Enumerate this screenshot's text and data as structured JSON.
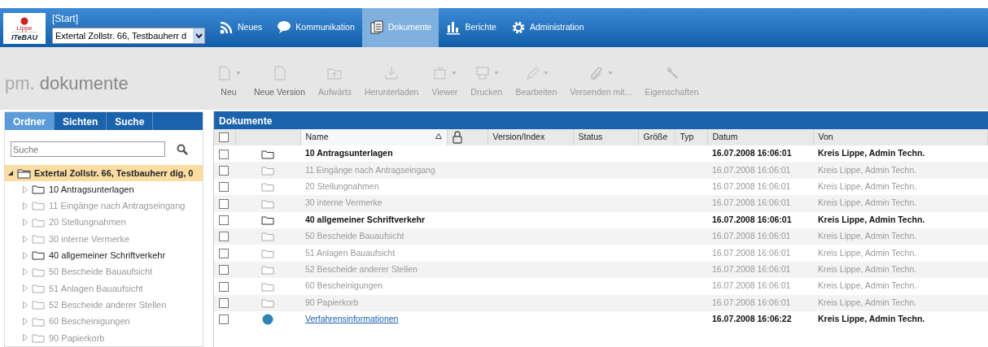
{
  "header": {
    "logo_top": "Lippe",
    "logo_bottom": "ITeBAU",
    "breadcrumb": "[Start]",
    "project_select": "Extertal Zollstr. 66,  Testbauherr d",
    "nav": [
      {
        "label": "Neues",
        "selected": false
      },
      {
        "label": "Kommunikation",
        "selected": false
      },
      {
        "label": "Dokumente",
        "selected": true
      },
      {
        "label": "Berichte",
        "selected": false
      },
      {
        "label": "Administration",
        "selected": false
      }
    ]
  },
  "module_title": {
    "prefix": "pm.",
    "name": "dokumente"
  },
  "toolbar": [
    {
      "label": "Neu",
      "dropdown": true,
      "disabled": false
    },
    {
      "label": "Neue Version",
      "dropdown": false,
      "disabled": false
    },
    {
      "label": "Aufwärts",
      "dropdown": false,
      "disabled": true
    },
    {
      "label": "Herunterladen",
      "dropdown": false,
      "disabled": true
    },
    {
      "label": "Viewer",
      "dropdown": true,
      "disabled": true
    },
    {
      "label": "Drucken",
      "dropdown": true,
      "disabled": true
    },
    {
      "label": "Bearbeiten",
      "dropdown": true,
      "disabled": true
    },
    {
      "label": "Versenden mit...",
      "dropdown": true,
      "disabled": true
    },
    {
      "label": "Eigenschaften",
      "dropdown": false,
      "disabled": true
    }
  ],
  "sidebar": {
    "tabs": [
      {
        "label": "Ordner",
        "selected": true
      },
      {
        "label": "Sichten",
        "selected": false
      },
      {
        "label": "Suche",
        "selected": false
      }
    ],
    "search": {
      "placeholder": "Suche"
    },
    "tree": [
      {
        "label": "Extertal Zollstr. 66, Testbauherr dig, 0",
        "expanded": true,
        "selected": true,
        "children": [
          {
            "label": "10 Antragsunterlagen",
            "dimmed": false
          },
          {
            "label": "11 Eingänge nach Antragseingang",
            "dimmed": true
          },
          {
            "label": "20 Stellungnahmen",
            "dimmed": true
          },
          {
            "label": "30 interne Vermerke",
            "dimmed": true
          },
          {
            "label": "40 allgemeiner Schriftverkehr",
            "dimmed": false
          },
          {
            "label": "50 Bescheide Bauaufsicht",
            "dimmed": true
          },
          {
            "label": "51 Anlagen Bauaufsicht",
            "dimmed": true
          },
          {
            "label": "52 Bescheide anderer Stellen",
            "dimmed": true
          },
          {
            "label": "60 Bescheinigungen",
            "dimmed": true
          },
          {
            "label": "90 Papierkorb",
            "dimmed": true
          }
        ]
      }
    ]
  },
  "documents": {
    "title": "Dokumente",
    "select_all_checked": false,
    "columns": [
      "Name",
      "Version/Index",
      "Status",
      "Größe",
      "Typ",
      "Datum",
      "Von"
    ],
    "rows": [
      {
        "kind": "folder",
        "name": "10 Antragsunterlagen",
        "datum": "16.07.2008 16:06:01",
        "von": "Kreis Lippe, Admin Techn.",
        "dimmed": false,
        "checked": false
      },
      {
        "kind": "folder",
        "name": "11 Eingänge nach Antragseingang",
        "datum": "16.07.2008 16:06:01",
        "von": "Kreis Lippe, Admin Techn.",
        "dimmed": true,
        "checked": false
      },
      {
        "kind": "folder",
        "name": "20 Stellungnahmen",
        "datum": "16.07.2008 16:06:01",
        "von": "Kreis Lippe, Admin Techn.",
        "dimmed": true,
        "checked": false
      },
      {
        "kind": "folder",
        "name": "30 interne Vermerke",
        "datum": "16.07.2008 16:06:01",
        "von": "Kreis Lippe, Admin Techn.",
        "dimmed": true,
        "checked": false
      },
      {
        "kind": "folder",
        "name": "40 allgemeiner Schriftverkehr",
        "datum": "16.07.2008 16:06:01",
        "von": "Kreis Lippe, Admin Techn.",
        "dimmed": false,
        "checked": false
      },
      {
        "kind": "folder",
        "name": "50 Bescheide Bauaufsicht",
        "datum": "16.07.2008 16:06:01",
        "von": "Kreis Lippe, Admin Techn.",
        "dimmed": true,
        "checked": false
      },
      {
        "kind": "folder",
        "name": "51 Anlagen Bauaufsicht",
        "datum": "16.07.2008 16:06:01",
        "von": "Kreis Lippe, Admin Techn.",
        "dimmed": true,
        "checked": false
      },
      {
        "kind": "folder",
        "name": "52 Bescheide anderer Stellen",
        "datum": "16.07.2008 16:06:01",
        "von": "Kreis Lippe, Admin Techn.",
        "dimmed": true,
        "checked": false
      },
      {
        "kind": "folder",
        "name": "60 Bescheinigungen",
        "datum": "16.07.2008 16:06:01",
        "von": "Kreis Lippe, Admin Techn.",
        "dimmed": true,
        "checked": false
      },
      {
        "kind": "folder",
        "name": "90 Papierkorb",
        "datum": "16.07.2008 16:06:01",
        "von": "Kreis Lippe, Admin Techn.",
        "dimmed": true,
        "checked": false
      },
      {
        "kind": "link",
        "name": "Verfahrensinformationen",
        "datum": "16.07.2008 16:06:22",
        "von": "Kreis Lippe, Admin Techn.",
        "dimmed": false,
        "checked": false
      }
    ]
  }
}
